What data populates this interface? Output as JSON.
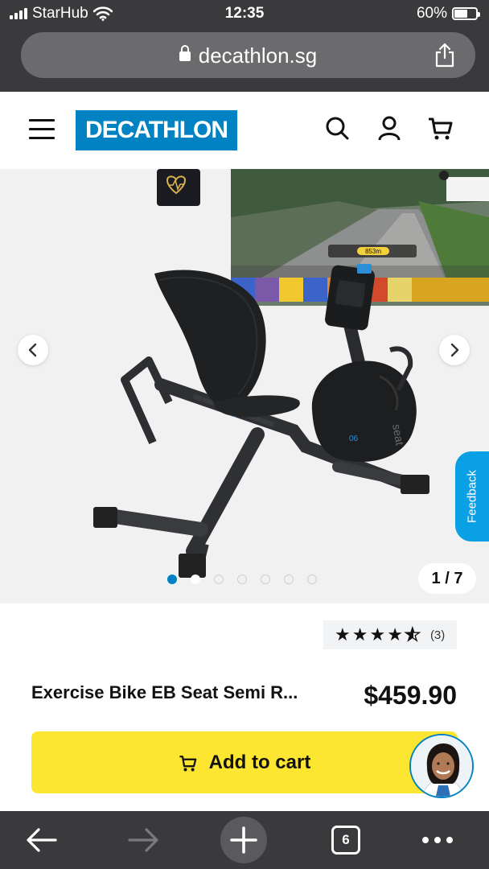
{
  "status_bar": {
    "carrier": "StarHub",
    "time": "12:35",
    "battery": "60%",
    "battery_level": 0.6
  },
  "browser": {
    "url": "decathlon.sg",
    "tab_count": "6"
  },
  "header": {
    "logo_text": "DECATHLON",
    "brand_color": "#0082c3",
    "icons": [
      "menu-icon",
      "search-icon",
      "account-icon",
      "cart-icon"
    ]
  },
  "gallery": {
    "counter": "1 / 7",
    "current_slide": 1,
    "total_slides": 7,
    "feedback_label": "Feedback",
    "screen_readout": "853m",
    "console_text": "06",
    "brand_on_bike": "seat"
  },
  "product": {
    "name": "Exercise Bike EB Seat Semi R...",
    "price": "$459.90",
    "rating": 4.5,
    "review_count": "(3)",
    "add_to_cart_label": "Add to cart",
    "button_color": "#fde631"
  }
}
